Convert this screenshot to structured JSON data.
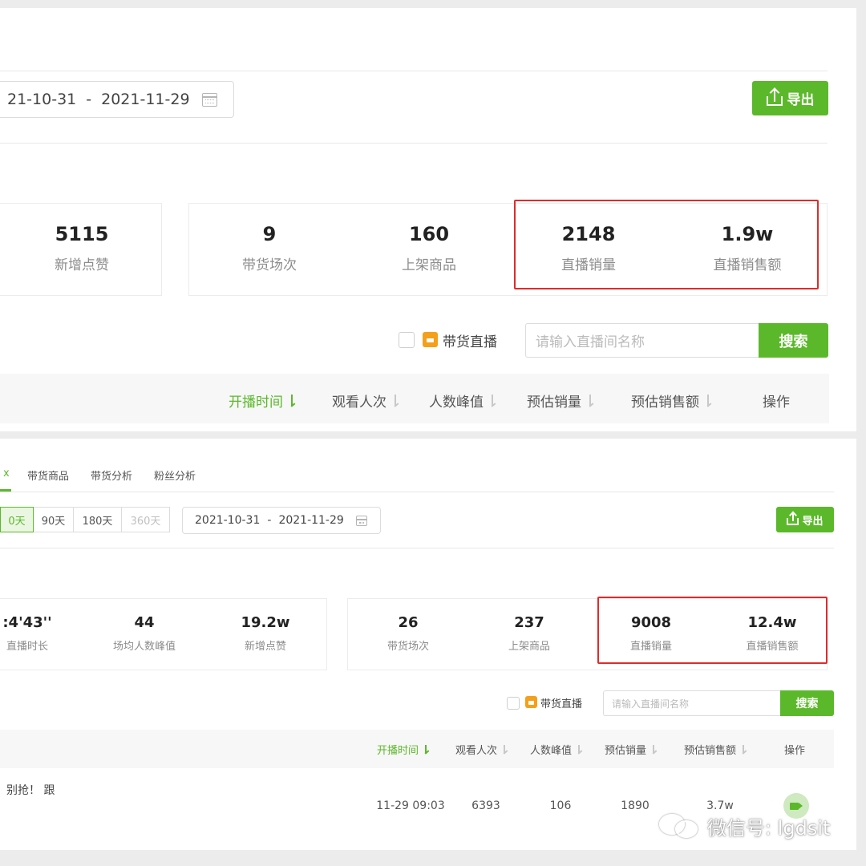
{
  "top": {
    "date_start": "21-10-31",
    "date_sep": "-",
    "date_end": "2021-11-29",
    "export_label": "导出",
    "stats_left": [
      {
        "value": "5115",
        "label": "新增点赞"
      }
    ],
    "stats_right": [
      {
        "value": "9",
        "label": "带货场次"
      },
      {
        "value": "160",
        "label": "上架商品"
      },
      {
        "value": "2148",
        "label": "直播销量"
      },
      {
        "value": "1.9w",
        "label": "直播销售额"
      }
    ],
    "filter_label": "带货直播",
    "search_placeholder": "请输入直播间名称",
    "search_button": "搜索",
    "columns": [
      "开播时间",
      "观看人次",
      "人数峰值",
      "预估销量",
      "预估销售额",
      "操作"
    ]
  },
  "bottom": {
    "tab_partial": "ⅹ",
    "tabs": [
      "带货商品",
      "带货分析",
      "粉丝分析"
    ],
    "ranges": [
      "0天",
      "90天",
      "180天",
      "360天"
    ],
    "date_start": "2021-10-31",
    "date_sep": "-",
    "date_end": "2021-11-29",
    "export_label": "导出",
    "stats_left": [
      {
        "value": ":4'43''",
        "label": "直播时长"
      },
      {
        "value": "44",
        "label": "场均人数峰值"
      },
      {
        "value": "19.2w",
        "label": "新增点赞"
      }
    ],
    "stats_right": [
      {
        "value": "26",
        "label": "带货场次"
      },
      {
        "value": "237",
        "label": "上架商品"
      },
      {
        "value": "9008",
        "label": "直播销量"
      },
      {
        "value": "12.4w",
        "label": "直播销售额"
      }
    ],
    "filter_label": "带货直播",
    "search_placeholder": "请输入直播间名称",
    "search_button": "搜索",
    "columns": [
      "开播时间",
      "观看人次",
      "人数峰值",
      "预估销量",
      "预估销售额",
      "操作"
    ],
    "row": {
      "title": "别抢！ 跟",
      "start_time": "11-29 09:03",
      "viewers": "6393",
      "peak": "106",
      "sales": "1890",
      "revenue": "3.7w"
    }
  },
  "watermark": "微信号: lgdsit",
  "colors": {
    "accent": "#5cb82b",
    "highlight": "#e02b2b",
    "live_badge": "#f4a01b"
  }
}
